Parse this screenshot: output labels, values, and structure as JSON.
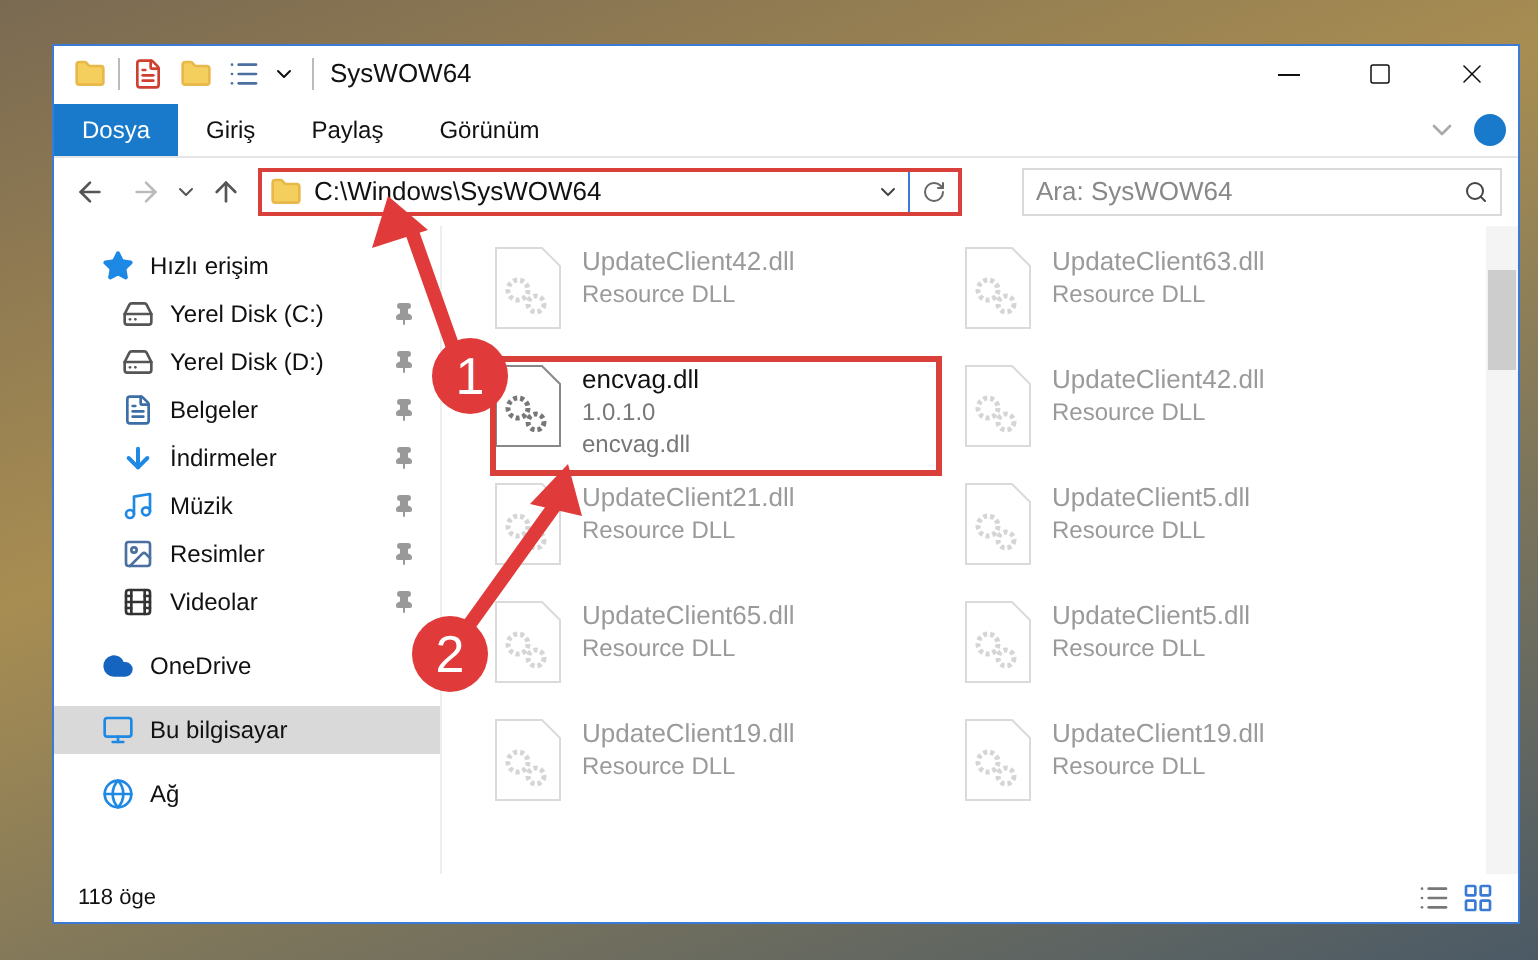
{
  "window": {
    "title": "SysWOW64"
  },
  "ribbon_tabs": [
    {
      "label": "Dosya",
      "selected": true
    },
    {
      "label": "Giriş",
      "selected": false
    },
    {
      "label": "Paylaş",
      "selected": false
    },
    {
      "label": "Görünüm",
      "selected": false
    }
  ],
  "address_bar": {
    "path": "C:\\Windows\\SysWOW64"
  },
  "search": {
    "placeholder": "Ara: SysWOW64"
  },
  "sidebar": {
    "items": [
      {
        "label": "Hızlı erişim",
        "kind": "star",
        "selected": false,
        "children": [
          {
            "label": "Yerel Disk (C:)",
            "kind": "drive_c",
            "pinned": true
          },
          {
            "label": "Yerel Disk (D:)",
            "kind": "drive",
            "pinned": true
          },
          {
            "label": "Belgeler",
            "kind": "document",
            "pinned": true
          },
          {
            "label": "İndirmeler",
            "kind": "download",
            "pinned": true
          },
          {
            "label": "Müzik",
            "kind": "music",
            "pinned": true
          },
          {
            "label": "Resimler",
            "kind": "picture",
            "pinned": true
          },
          {
            "label": "Videolar",
            "kind": "video",
            "pinned": true
          }
        ]
      },
      {
        "label": "OneDrive",
        "kind": "cloud",
        "selected": false
      },
      {
        "label": "Bu bilgisayar",
        "kind": "computer",
        "selected": true
      },
      {
        "label": "Ağ",
        "kind": "network",
        "selected": false
      }
    ]
  },
  "files": [
    {
      "lines": [
        "UpdateClient42.dll",
        "Resource DLL"
      ],
      "dimmed": true
    },
    {
      "lines": [
        "UpdateClient63.dll",
        "Resource DLL"
      ],
      "dimmed": true
    },
    {
      "lines": [
        "encvag.dll",
        "1.0.1.0",
        "encvag.dll"
      ],
      "dimmed": false
    },
    {
      "lines": [
        "UpdateClient42.dll",
        "Resource DLL"
      ],
      "dimmed": true
    },
    {
      "lines": [
        "UpdateClient21.dll",
        "Resource DLL"
      ],
      "dimmed": true
    },
    {
      "lines": [
        "UpdateClient5.dll",
        "Resource DLL"
      ],
      "dimmed": true
    },
    {
      "lines": [
        "UpdateClient65.dll",
        "Resource DLL"
      ],
      "dimmed": true
    },
    {
      "lines": [
        "UpdateClient5.dll",
        "Resource DLL"
      ],
      "dimmed": true
    },
    {
      "lines": [
        "UpdateClient19.dll",
        "Resource DLL"
      ],
      "dimmed": true
    },
    {
      "lines": [
        "UpdateClient19.dll",
        "Resource DLL"
      ],
      "dimmed": true
    }
  ],
  "status_bar": {
    "count": "118 öge"
  },
  "callouts": [
    {
      "number": "1"
    },
    {
      "number": "2"
    }
  ]
}
